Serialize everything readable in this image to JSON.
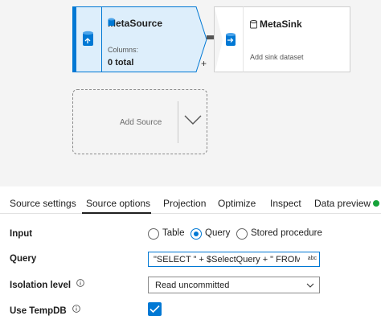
{
  "canvas": {
    "source_node": {
      "title": "MetaSource",
      "columns_label": "Columns:",
      "columns_value": "0 total"
    },
    "sink_node": {
      "title": "MetaSink",
      "subtitle": "Add sink dataset"
    },
    "connector_add": "+",
    "add_source": {
      "label": "Add Source"
    }
  },
  "tabs": [
    {
      "label": "Source settings"
    },
    {
      "label": "Source options"
    },
    {
      "label": "Projection"
    },
    {
      "label": "Optimize"
    },
    {
      "label": "Inspect"
    },
    {
      "label": "Data preview"
    }
  ],
  "active_tab": "Source options",
  "form": {
    "input": {
      "label": "Input",
      "options": [
        "Table",
        "Query",
        "Stored procedure"
      ],
      "selected": "Query"
    },
    "query": {
      "label": "Query",
      "value": "\"SELECT \" + $SelectQuery + \" FROM \"...",
      "badge": "abc"
    },
    "isolation_level": {
      "label": "Isolation level",
      "value": "Read uncommitted"
    },
    "use_tempdb": {
      "label": "Use TempDB",
      "checked": true
    }
  },
  "colors": {
    "accent": "#0078d4",
    "status_dot": "#17a33a",
    "canvas_bg": "#f4f4f4"
  },
  "icons": [
    "source-dataset-icon",
    "database-icon",
    "sink-dataset-icon",
    "chevron-down-icon",
    "info-icon",
    "checkmark-icon"
  ]
}
